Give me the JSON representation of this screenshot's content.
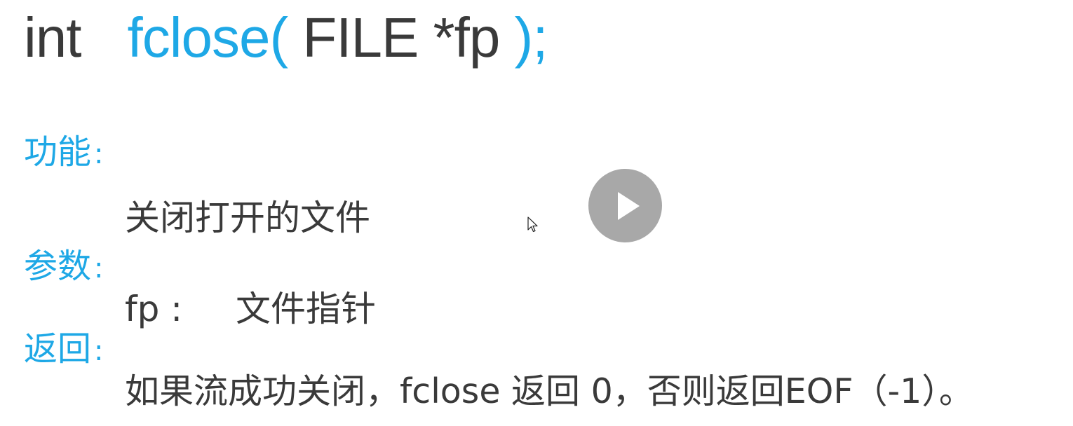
{
  "signature": {
    "return_type": "int",
    "function_name": "fclose",
    "open_paren": "(",
    "args": " FILE *fp ",
    "close": ");"
  },
  "sections": {
    "function": {
      "heading": "功能",
      "colon": ":",
      "text": "关闭打开的文件"
    },
    "params": {
      "heading": "参数",
      "colon": ":",
      "param_name": "fp :",
      "param_desc": "文件指针"
    },
    "returns": {
      "heading": "返回",
      "colon": ":",
      "text": "如果流成功关闭，fclose 返回 0，否则返回EOF（-1）。"
    }
  },
  "overlay": {
    "play_icon": "play-icon",
    "cursor_icon": "mouse-pointer-icon"
  },
  "colors": {
    "accent": "#1ea8e6",
    "text": "#3a3a3a",
    "play_button": "#a8a8a8"
  }
}
